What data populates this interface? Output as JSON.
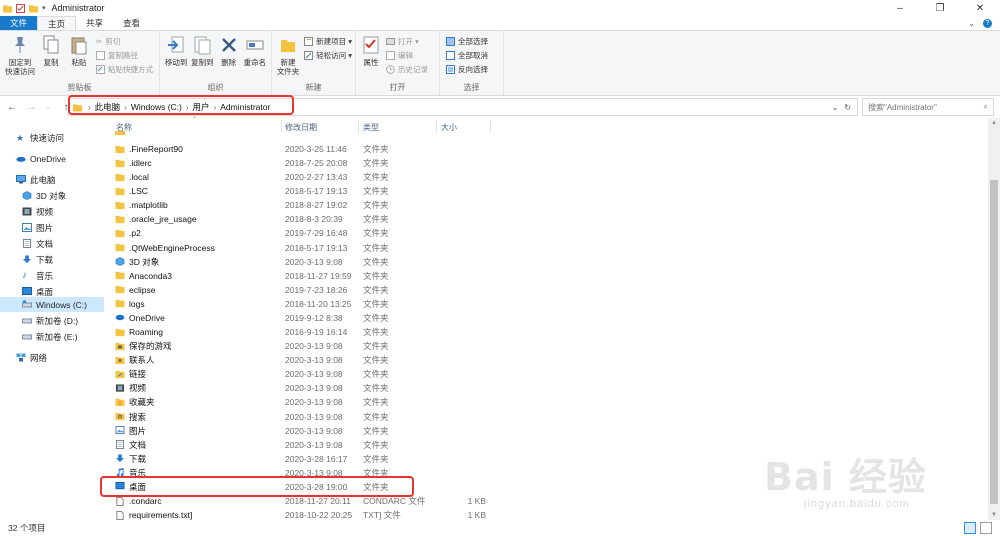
{
  "window": {
    "title": "Administrator"
  },
  "ribbon_tabs": [
    {
      "label": "文件"
    },
    {
      "label": "主页"
    },
    {
      "label": "共享"
    },
    {
      "label": "查看"
    }
  ],
  "ribbon": {
    "clipboard": {
      "label": "剪贴板",
      "pin_quick_access": "固定到\n快速访问",
      "copy": "复制",
      "paste": "粘贴",
      "cut": "剪切",
      "copy_path": "复制路径",
      "paste_shortcut": "粘贴快捷方式"
    },
    "organize": {
      "label": "组织",
      "move_to": "移动到",
      "copy_to": "复制到",
      "delete": "删除",
      "rename": "重命名"
    },
    "new": {
      "label": "新建",
      "new_folder": "新建\n文件夹",
      "new_item": "新建项目 ▾",
      "easy_access": "轻松访问 ▾"
    },
    "open": {
      "label": "打开",
      "properties": "属性",
      "open": "打开 ▾",
      "edit": "编辑",
      "history": "历史记录"
    },
    "select": {
      "label": "选择",
      "select_all": "全部选择",
      "select_none": "全部取消",
      "invert": "反向选择"
    }
  },
  "address": {
    "segments": [
      "此电脑",
      "Windows (C:)",
      "用户",
      "Administrator"
    ],
    "search_placeholder": "搜索\"Administrator\""
  },
  "sidebar": {
    "items": [
      {
        "label": "快速访问",
        "icon": "star-icon"
      },
      {
        "label": "OneDrive",
        "icon": "cloud-icon"
      },
      {
        "label": "此电脑",
        "icon": "computer-icon"
      },
      {
        "label": "3D 对象",
        "icon": "cube-icon"
      },
      {
        "label": "视频",
        "icon": "video-icon"
      },
      {
        "label": "图片",
        "icon": "picture-icon"
      },
      {
        "label": "文档",
        "icon": "document-icon"
      },
      {
        "label": "下载",
        "icon": "download-icon"
      },
      {
        "label": "音乐",
        "icon": "music-icon"
      },
      {
        "label": "桌面",
        "icon": "desktop-icon"
      },
      {
        "label": "Windows (C:)",
        "icon": "drive-icon"
      },
      {
        "label": "新加卷 (D:)",
        "icon": "drive-icon"
      },
      {
        "label": "新加卷 (E:)",
        "icon": "drive-icon"
      },
      {
        "label": "网络",
        "icon": "network-icon"
      }
    ]
  },
  "columns": {
    "name": "名称",
    "date": "修改日期",
    "type": "类型",
    "size": "大小"
  },
  "files": [
    {
      "name": ".FineReport90",
      "date": "2020-3-25 11:46",
      "type": "文件夹",
      "size": "",
      "icon": "folder-icon"
    },
    {
      "name": ".idlerc",
      "date": "2018-7-25 20:08",
      "type": "文件夹",
      "size": "",
      "icon": "folder-icon"
    },
    {
      "name": ".local",
      "date": "2020-2-27 13:43",
      "type": "文件夹",
      "size": "",
      "icon": "folder-icon"
    },
    {
      "name": ".LSC",
      "date": "2018-5-17 19:13",
      "type": "文件夹",
      "size": "",
      "icon": "folder-icon"
    },
    {
      "name": ".matplotlib",
      "date": "2018-8-27 19:02",
      "type": "文件夹",
      "size": "",
      "icon": "folder-icon"
    },
    {
      "name": ".oracle_jre_usage",
      "date": "2018-8-3 20:39",
      "type": "文件夹",
      "size": "",
      "icon": "folder-icon"
    },
    {
      "name": ".p2",
      "date": "2019-7-29 16:48",
      "type": "文件夹",
      "size": "",
      "icon": "folder-icon"
    },
    {
      "name": ".QtWebEngineProcess",
      "date": "2018-5-17 19:13",
      "type": "文件夹",
      "size": "",
      "icon": "folder-icon"
    },
    {
      "name": "3D 对象",
      "date": "2020-3-13 9:08",
      "type": "文件夹",
      "size": "",
      "icon": "cube-icon"
    },
    {
      "name": "Anaconda3",
      "date": "2018-11-27 19:59",
      "type": "文件夹",
      "size": "",
      "icon": "folder-icon"
    },
    {
      "name": "eclipse",
      "date": "2019-7-23 18:26",
      "type": "文件夹",
      "size": "",
      "icon": "folder-icon"
    },
    {
      "name": "logs",
      "date": "2018-11-20 13:25",
      "type": "文件夹",
      "size": "",
      "icon": "folder-icon"
    },
    {
      "name": "OneDrive",
      "date": "2019-9-12 8:38",
      "type": "文件夹",
      "size": "",
      "icon": "cloud-icon"
    },
    {
      "name": "Roaming",
      "date": "2016-9-19 16:14",
      "type": "文件夹",
      "size": "",
      "icon": "folder-icon"
    },
    {
      "name": "保存的游戏",
      "date": "2020-3-13 9:08",
      "type": "文件夹",
      "size": "",
      "icon": "saved-games-icon"
    },
    {
      "name": "联系人",
      "date": "2020-3-13 9:08",
      "type": "文件夹",
      "size": "",
      "icon": "contacts-icon"
    },
    {
      "name": "链接",
      "date": "2020-3-13 9:08",
      "type": "文件夹",
      "size": "",
      "icon": "links-icon"
    },
    {
      "name": "视频",
      "date": "2020-3-13 9:08",
      "type": "文件夹",
      "size": "",
      "icon": "video-icon"
    },
    {
      "name": "收藏夹",
      "date": "2020-3-13 9:08",
      "type": "文件夹",
      "size": "",
      "icon": "favorites-icon"
    },
    {
      "name": "搜索",
      "date": "2020-3-13 9:08",
      "type": "文件夹",
      "size": "",
      "icon": "search-folder-icon"
    },
    {
      "name": "图片",
      "date": "2020-3-13 9:08",
      "type": "文件夹",
      "size": "",
      "icon": "picture-icon"
    },
    {
      "name": "文档",
      "date": "2020-3-13 9:08",
      "type": "文件夹",
      "size": "",
      "icon": "document-icon"
    },
    {
      "name": "下载",
      "date": "2020-3-28 16:17",
      "type": "文件夹",
      "size": "",
      "icon": "download-icon"
    },
    {
      "name": "音乐",
      "date": "2020-3-13 9:08",
      "type": "文件夹",
      "size": "",
      "icon": "music-icon"
    },
    {
      "name": "桌面",
      "date": "2020-3-28 19:00",
      "type": "文件夹",
      "size": "",
      "icon": "desktop-icon"
    },
    {
      "name": ".condarc",
      "date": "2018-11-27 20:11",
      "type": "CONDARC 文件",
      "size": "1 KB",
      "icon": "file-icon"
    },
    {
      "name": "requirements.txt]",
      "date": "2018-10-22 20:25",
      "type": "TXT] 文件",
      "size": "1 KB",
      "icon": "file-icon"
    }
  ],
  "status": {
    "item_count": "32 个项目"
  },
  "watermark": {
    "brand": "Bai 经验",
    "url": "jingyan.baidu.com"
  },
  "colors": {
    "accent": "#1979ca",
    "highlight_red": "#e8342f",
    "folder": "#f5c242",
    "selected": "#cce8ff"
  }
}
